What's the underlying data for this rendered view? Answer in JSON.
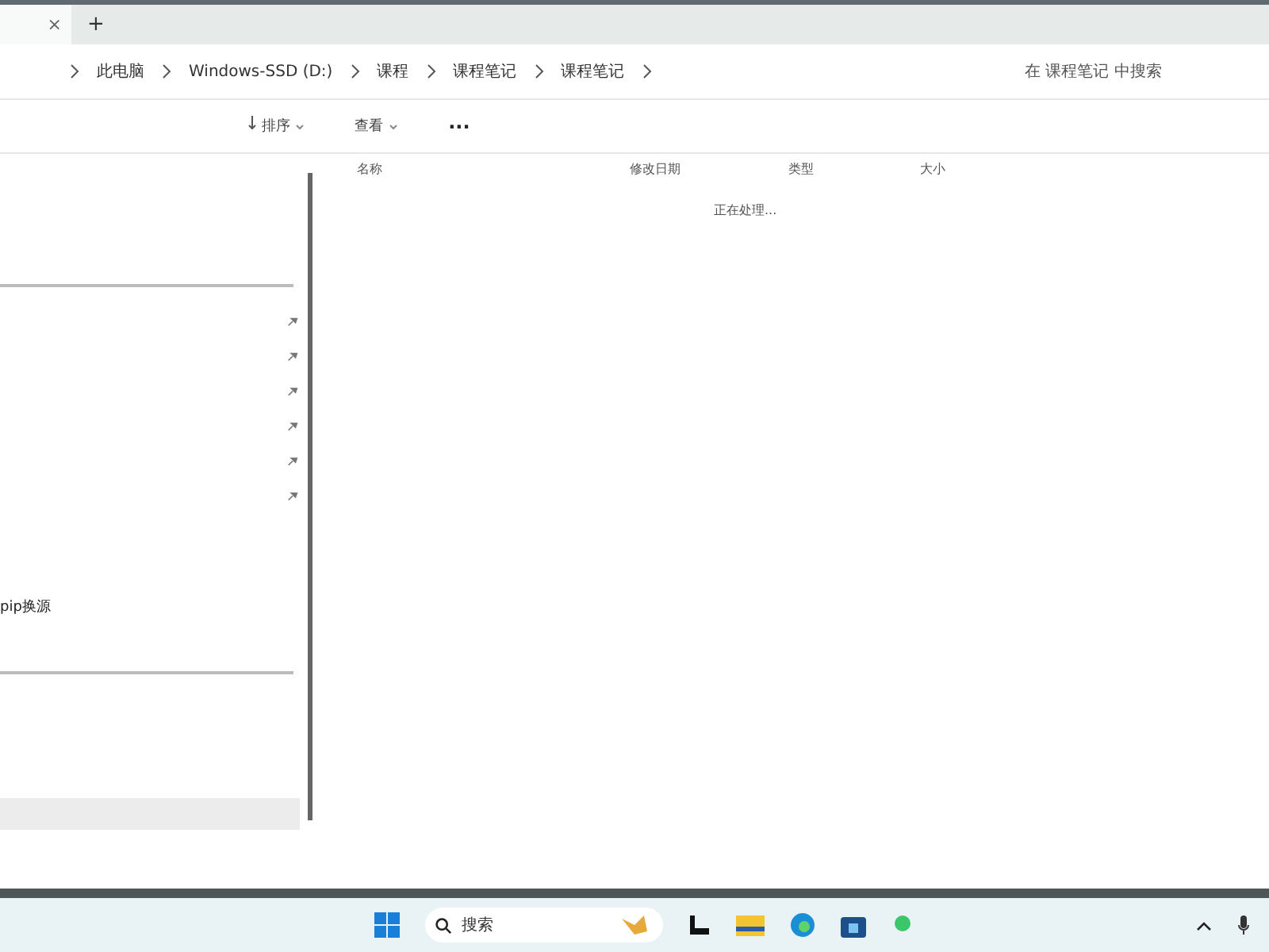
{
  "tab": {
    "close": "×",
    "new": "+"
  },
  "breadcrumb": [
    {
      "label": "此电脑"
    },
    {
      "label": "Windows-SSD (D:)"
    },
    {
      "label": "课程"
    },
    {
      "label": "课程笔记"
    },
    {
      "label": "课程笔记"
    }
  ],
  "search": {
    "placeholder": "在 课程笔记 中搜索"
  },
  "toolbar": [
    {
      "kind": "sort",
      "label": "排序"
    },
    {
      "kind": "view",
      "label": "查看"
    },
    {
      "kind": "more",
      "label": "···"
    }
  ],
  "columns": [
    {
      "label": "名称"
    },
    {
      "label": "修改日期"
    },
    {
      "label": "类型"
    },
    {
      "label": "大小"
    }
  ],
  "status": "正在处理...",
  "sidebar": {
    "pinned": [
      {
        "pinned": true
      },
      {
        "pinned": true
      },
      {
        "pinned": true
      },
      {
        "pinned": true
      },
      {
        "pinned": true
      },
      {
        "pinned": true
      }
    ],
    "item": "pip换源"
  },
  "taskbar": {
    "search_placeholder": "搜索"
  }
}
